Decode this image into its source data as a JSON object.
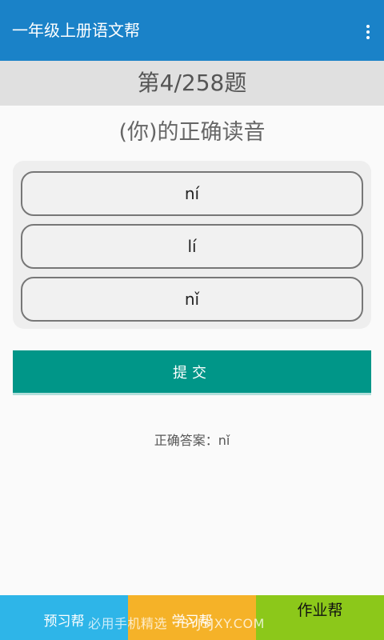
{
  "appbar": {
    "title": "一年级上册语文帮",
    "overflow_icon": "more-vert-icon"
  },
  "progress": {
    "text": "第4/258题",
    "current": 4,
    "total": 258
  },
  "question": {
    "text": "(你)的正确读音"
  },
  "options": [
    {
      "label": "ní"
    },
    {
      "label": "lí"
    },
    {
      "label": "nǐ"
    }
  ],
  "submit": {
    "label": "提交"
  },
  "answer": {
    "text": "正确答案：nǐ"
  },
  "bottom_nav": {
    "tabs": [
      {
        "label": "预习帮"
      },
      {
        "label": "学习帮"
      },
      {
        "label": "作业帮"
      }
    ]
  },
  "watermark": "必用手机精选 · BYJSJXY.COM",
  "colors": {
    "appbar": "#1a82c8",
    "submit_button": "#009688",
    "tab_preview": "#2eb5e8",
    "tab_study": "#f5b228",
    "tab_homework": "#8cc81a"
  }
}
